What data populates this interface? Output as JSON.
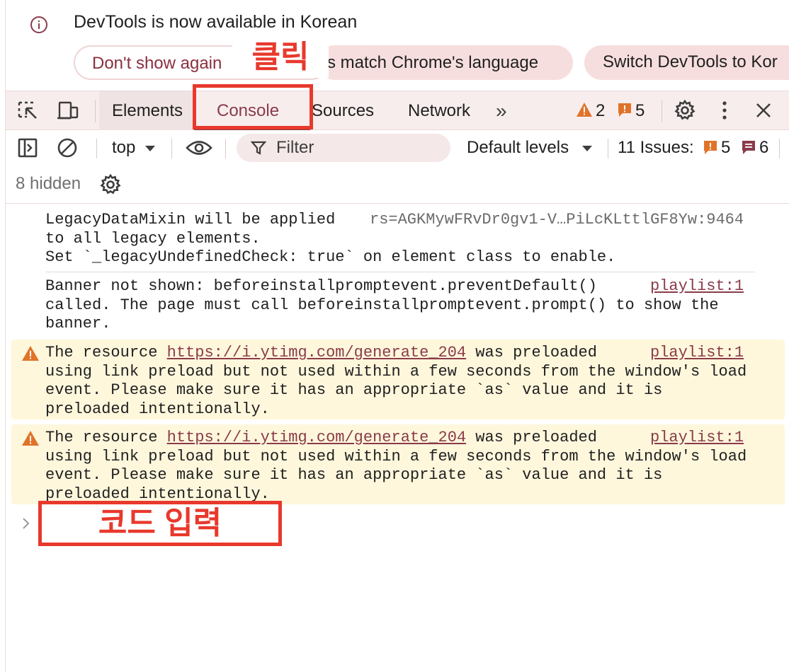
{
  "banner": {
    "message": "DevTools is now available in Korean",
    "buttons": {
      "dont_show": "Don't show again",
      "match_language": "s match Chrome's language",
      "switch_language": "Switch DevTools to Kor"
    }
  },
  "annotations": {
    "click_label": "클릭",
    "code_input_label": "코드 입력"
  },
  "tabs": {
    "elements": "Elements",
    "console": "Console",
    "sources": "Sources",
    "network": "Network",
    "more": "»",
    "warnings_count": "2",
    "errors_count": "5"
  },
  "toolbar": {
    "context": "top",
    "filter_placeholder": "Filter",
    "levels": "Default levels",
    "issues_label": "11 Issues:",
    "issues_errors": "5",
    "issues_info": "6",
    "hidden": "8 hidden"
  },
  "messages": [
    {
      "type": "info",
      "lines": [
        "LegacyDataMixin will be applied",
        "to all legacy elements.",
        "Set `_legacyUndefinedCheck: true` on element class to enable."
      ],
      "source": "rs=AGKMywFRvDr0gv1-V…PiLcKLttlGF8Yw:9464"
    },
    {
      "type": "info",
      "lines": [
        "Banner not shown: beforeinstallpromptevent.preventDefault()",
        "called. The page must call beforeinstallpromptevent.prompt() to show the",
        "banner."
      ],
      "source": "playlist:1"
    },
    {
      "type": "warning",
      "prefix": "The resource ",
      "url": "https://i.ytimg.com/generate_204",
      "suffix": " was preloaded",
      "lines": [
        "using link preload but not used within a few seconds from the window's load",
        "event. Please make sure it has an appropriate `as` value and it is",
        "preloaded intentionally."
      ],
      "source": "playlist:1"
    },
    {
      "type": "warning",
      "prefix": "The resource ",
      "url": "https://i.ytimg.com/generate_204",
      "suffix": " was preloaded",
      "lines": [
        "using link preload but not used within a few seconds from the window's load",
        "event. Please make sure it has an appropriate `as` value and it is",
        "preloaded intentionally."
      ],
      "source": "playlist:1"
    }
  ],
  "colors": {
    "accent": "#8a3b4a",
    "annotation_red": "#e8392c",
    "warning_bg": "#fef7dc",
    "warning_icon": "#e0732a"
  }
}
